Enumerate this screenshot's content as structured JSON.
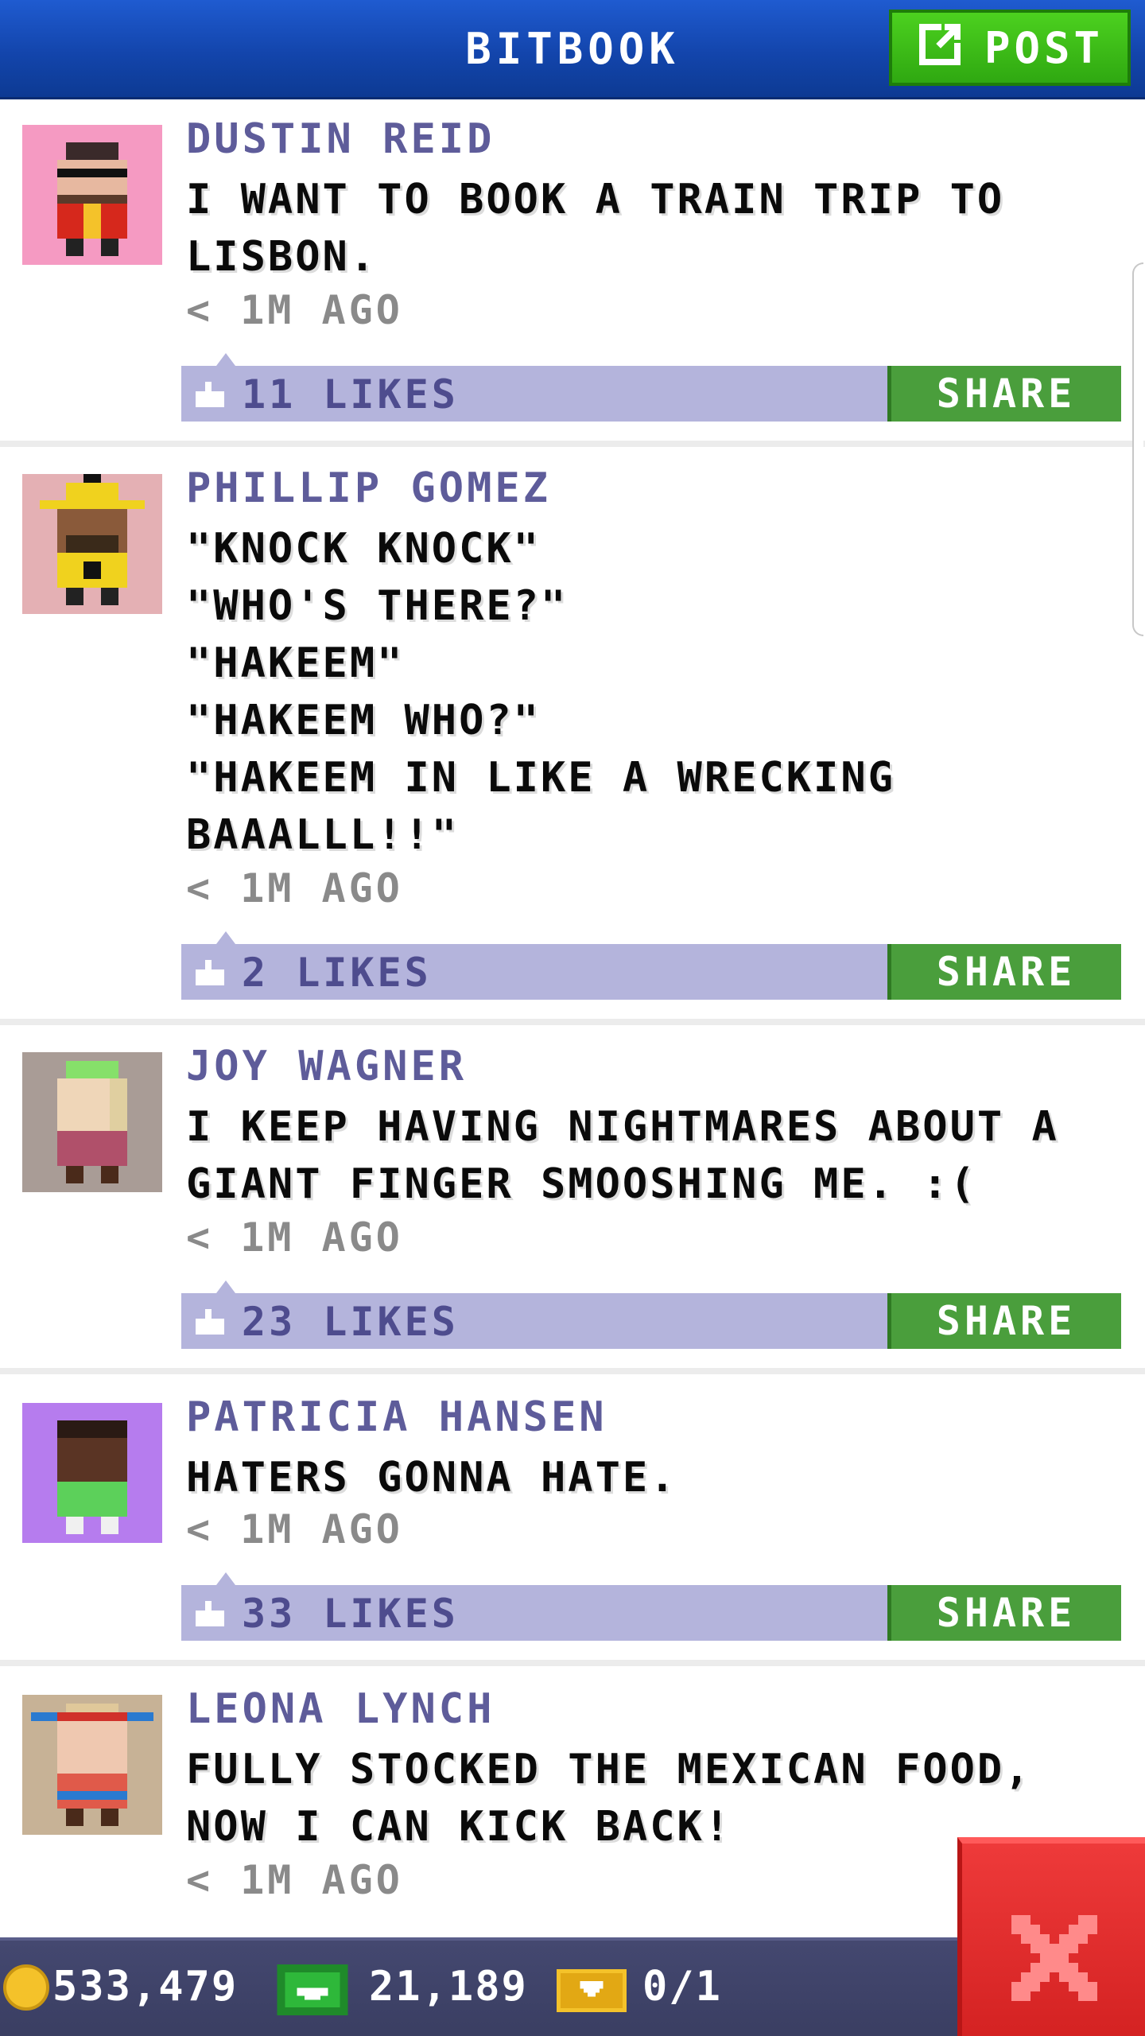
{
  "header": {
    "title": "BITBOOK",
    "post_label": "POST"
  },
  "posts": [
    {
      "author": "DUSTIN REID",
      "text": "I WANT TO BOOK A TRAIN TRIP TO\nLISBON.",
      "time": "< 1M AGO",
      "likes": "11 LIKES",
      "share": "SHARE",
      "avatar_bg": "#f59ac2"
    },
    {
      "author": "PHILLIP GOMEZ",
      "text": "\"KNOCK KNOCK\"\n\"WHO'S THERE?\"\n\"HAKEEM\"\n\"HAKEEM WHO?\"\n\"HAKEEM IN LIKE A WRECKING\nBAAALLL!!\"",
      "time": "< 1M AGO",
      "likes": "2 LIKES",
      "share": "SHARE",
      "avatar_bg": "#e4b0b4"
    },
    {
      "author": "JOY WAGNER",
      "text": "I KEEP HAVING NIGHTMARES ABOUT A\nGIANT FINGER SMOOSHING ME. :(",
      "time": "< 1M AGO",
      "likes": "23 LIKES",
      "share": "SHARE",
      "avatar_bg": "#a99c96"
    },
    {
      "author": "PATRICIA HANSEN",
      "text": "HATERS GONNA HATE.",
      "time": "< 1M AGO",
      "likes": "33 LIKES",
      "share": "SHARE",
      "avatar_bg": "#b67cee"
    },
    {
      "author": "LEONA LYNCH",
      "text": "FULLY STOCKED THE MEXICAN FOOD,\nNOW I CAN KICK BACK!",
      "time": "< 1M AGO",
      "likes": "",
      "share": "",
      "avatar_bg": "#c7b296"
    }
  ],
  "footer": {
    "coins": "533,479",
    "bux": "21,189",
    "tickets": "0/1"
  }
}
